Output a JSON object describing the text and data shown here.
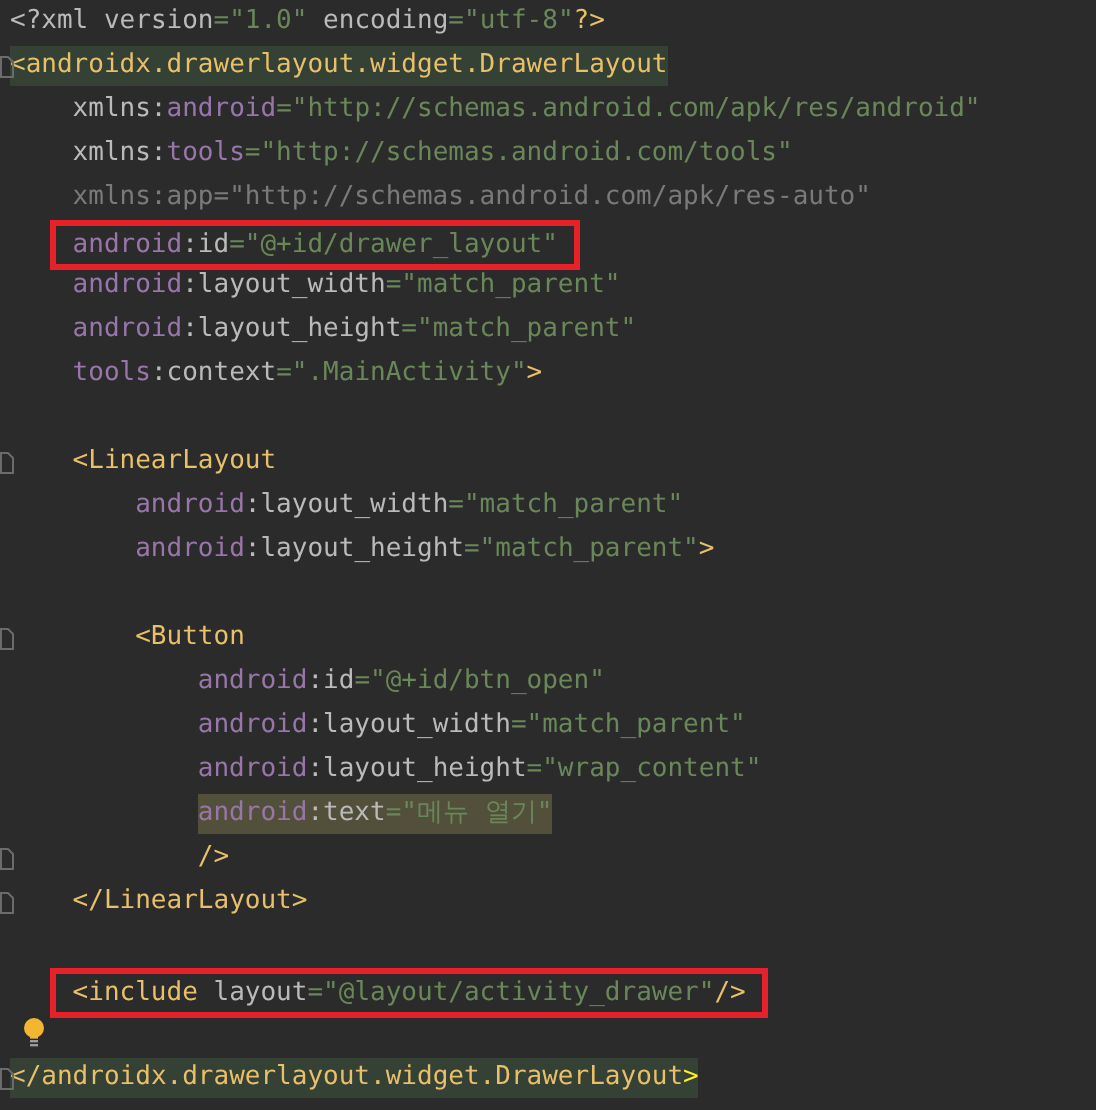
{
  "editor": {
    "lines": [
      {
        "kind": "code",
        "fold": false,
        "bulb": false,
        "boxed": false,
        "matched": false,
        "marked": false,
        "tokens": [
          {
            "kind": "name",
            "t": "<?xml version"
          },
          {
            "kind": "str",
            "t": "=\"1.0\""
          },
          {
            "kind": "name",
            "t": " encoding"
          },
          {
            "kind": "str",
            "t": "=\"utf-8\""
          },
          {
            "kind": "tag",
            "t": "?>"
          }
        ]
      },
      {
        "kind": "code",
        "fold": true,
        "bulb": false,
        "boxed": false,
        "matched": true,
        "marked": false,
        "tokens": [
          {
            "kind": "tag",
            "t": "<androidx.drawerlayout.widget.DrawerLayout"
          }
        ],
        "children": [
          {
            "kind": "code",
            "fold": false,
            "bulb": false,
            "boxed": false,
            "matched": false,
            "marked": false,
            "tokens": [
              {
                "kind": "name",
                "t": "xmlns:"
              },
              {
                "kind": "ns",
                "t": "android"
              },
              {
                "kind": "str",
                "t": "=\"http://schemas.android.com/apk/res/android\""
              }
            ]
          },
          {
            "kind": "code",
            "fold": false,
            "bulb": false,
            "boxed": false,
            "matched": false,
            "marked": false,
            "tokens": [
              {
                "kind": "name",
                "t": "xmlns:"
              },
              {
                "kind": "ns",
                "t": "tools"
              },
              {
                "kind": "str",
                "t": "=\"http://schemas.android.com/tools\""
              }
            ]
          },
          {
            "kind": "code",
            "fold": false,
            "bulb": false,
            "boxed": false,
            "matched": false,
            "marked": false,
            "tokens": [
              {
                "kind": "dim",
                "t": "xmlns:app=\"http://schemas.android.com/apk/res-auto\""
              }
            ]
          },
          {
            "kind": "code",
            "fold": false,
            "bulb": false,
            "boxed": true,
            "matched": false,
            "marked": false,
            "tokens": [
              {
                "kind": "ns",
                "t": "android"
              },
              {
                "kind": "name",
                "t": ":id"
              },
              {
                "kind": "str",
                "t": "=\"@+id/drawer_layout\""
              }
            ]
          },
          {
            "kind": "code",
            "fold": false,
            "bulb": false,
            "boxed": false,
            "matched": false,
            "marked": false,
            "tokens": [
              {
                "kind": "ns",
                "t": "android"
              },
              {
                "kind": "name",
                "t": ":layout_width"
              },
              {
                "kind": "str",
                "t": "=\"match_parent\""
              }
            ]
          },
          {
            "kind": "code",
            "fold": false,
            "bulb": false,
            "boxed": false,
            "matched": false,
            "marked": false,
            "tokens": [
              {
                "kind": "ns",
                "t": "android"
              },
              {
                "kind": "name",
                "t": ":layout_height"
              },
              {
                "kind": "str",
                "t": "=\"match_parent\""
              }
            ]
          },
          {
            "kind": "code",
            "fold": false,
            "bulb": false,
            "boxed": false,
            "matched": false,
            "marked": false,
            "tokens": [
              {
                "kind": "ns",
                "t": "tools"
              },
              {
                "kind": "name",
                "t": ":context"
              },
              {
                "kind": "str",
                "t": "=\".MainActivity\""
              },
              {
                "kind": "tag",
                "t": ">"
              }
            ]
          },
          {
            "kind": "blank",
            "fold": false,
            "bulb": false
          },
          {
            "kind": "code",
            "fold": true,
            "bulb": false,
            "boxed": false,
            "matched": false,
            "marked": false,
            "tokens": [
              {
                "kind": "tag",
                "t": "<LinearLayout"
              }
            ],
            "children": [
              {
                "kind": "code",
                "fold": false,
                "bulb": false,
                "boxed": false,
                "matched": false,
                "marked": false,
                "tokens": [
                  {
                    "kind": "ns",
                    "t": "android"
                  },
                  {
                    "kind": "name",
                    "t": ":layout_width"
                  },
                  {
                    "kind": "str",
                    "t": "=\"match_parent\""
                  }
                ]
              },
              {
                "kind": "code",
                "fold": false,
                "bulb": false,
                "boxed": false,
                "matched": false,
                "marked": false,
                "tokens": [
                  {
                    "kind": "ns",
                    "t": "android"
                  },
                  {
                    "kind": "name",
                    "t": ":layout_height"
                  },
                  {
                    "kind": "str",
                    "t": "=\"match_parent\""
                  },
                  {
                    "kind": "tag",
                    "t": ">"
                  }
                ]
              },
              {
                "kind": "blank",
                "fold": false,
                "bulb": false
              },
              {
                "kind": "code",
                "fold": true,
                "bulb": false,
                "boxed": false,
                "matched": false,
                "marked": false,
                "tokens": [
                  {
                    "kind": "tag",
                    "t": "<Button"
                  }
                ],
                "children": [
                  {
                    "kind": "code",
                    "fold": false,
                    "bulb": false,
                    "boxed": false,
                    "matched": false,
                    "marked": false,
                    "tokens": [
                      {
                        "kind": "ns",
                        "t": "android"
                      },
                      {
                        "kind": "name",
                        "t": ":id"
                      },
                      {
                        "kind": "str",
                        "t": "=\"@+id/btn_open\""
                      }
                    ]
                  },
                  {
                    "kind": "code",
                    "fold": false,
                    "bulb": false,
                    "boxed": false,
                    "matched": false,
                    "marked": false,
                    "tokens": [
                      {
                        "kind": "ns",
                        "t": "android"
                      },
                      {
                        "kind": "name",
                        "t": ":layout_width"
                      },
                      {
                        "kind": "str",
                        "t": "=\"match_parent\""
                      }
                    ]
                  },
                  {
                    "kind": "code",
                    "fold": false,
                    "bulb": false,
                    "boxed": false,
                    "matched": false,
                    "marked": false,
                    "tokens": [
                      {
                        "kind": "ns",
                        "t": "android"
                      },
                      {
                        "kind": "name",
                        "t": ":layout_height"
                      },
                      {
                        "kind": "str",
                        "t": "=\"wrap_content\""
                      }
                    ]
                  },
                  {
                    "kind": "code",
                    "fold": false,
                    "bulb": false,
                    "boxed": false,
                    "matched": false,
                    "marked": true,
                    "tokens": [
                      {
                        "kind": "ns",
                        "t": "android"
                      },
                      {
                        "kind": "name",
                        "t": ":text"
                      },
                      {
                        "kind": "str",
                        "t": "=\"메뉴 열기\""
                      }
                    ]
                  },
                  {
                    "kind": "code",
                    "fold": true,
                    "bulb": false,
                    "boxed": false,
                    "matched": false,
                    "marked": false,
                    "tokens": [
                      {
                        "kind": "tag",
                        "t": "/>"
                      }
                    ]
                  }
                ]
              }
            ]
          },
          {
            "kind": "code",
            "fold": true,
            "bulb": false,
            "boxed": false,
            "matched": false,
            "marked": false,
            "tokens": [
              {
                "kind": "tag",
                "t": "</LinearLayout>"
              }
            ]
          },
          {
            "kind": "blank",
            "fold": false,
            "bulb": false
          },
          {
            "kind": "code",
            "fold": false,
            "bulb": false,
            "boxed": true,
            "matched": false,
            "marked": false,
            "tokens": [
              {
                "kind": "tag",
                "t": "<include"
              },
              {
                "kind": "name",
                "t": " layout"
              },
              {
                "kind": "str",
                "t": "=\"@layout/activity_drawer\""
              },
              {
                "kind": "tag",
                "t": "/>"
              }
            ]
          },
          {
            "kind": "blank",
            "fold": false,
            "bulb": true
          }
        ]
      },
      {
        "kind": "code",
        "fold": true,
        "bulb": false,
        "boxed": false,
        "matched": true,
        "marked": false,
        "tokens": [
          {
            "kind": "tag",
            "t": "</androidx.drawerlayout.widget.DrawerLayout"
          },
          {
            "kind": "hl",
            "t": ">"
          }
        ]
      }
    ]
  }
}
